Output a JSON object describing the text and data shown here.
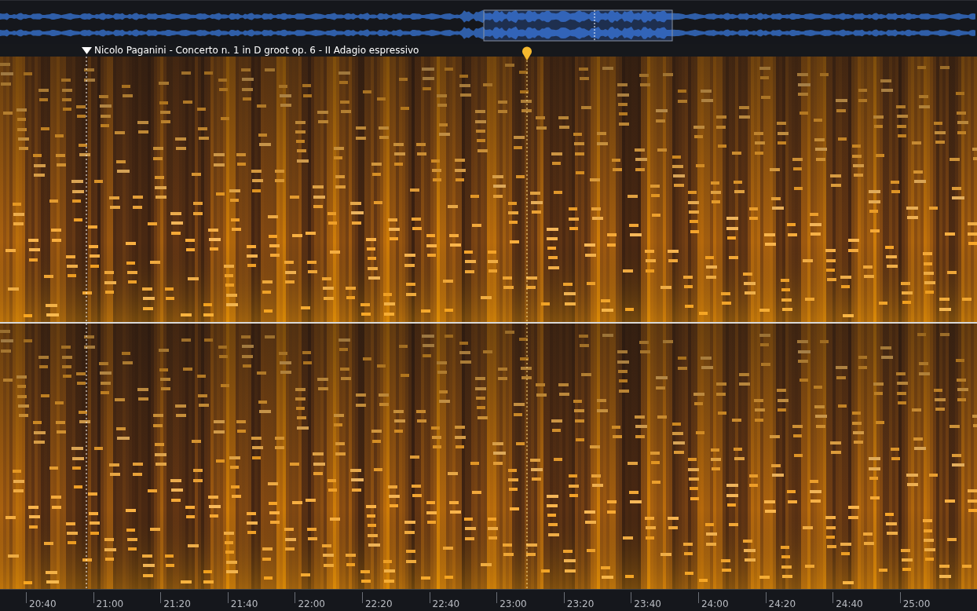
{
  "marker": {
    "label": "Nicolo Paganini -  Concerto n. 1 in D groot op. 6 - II Adagio espressivo"
  },
  "timeline": {
    "ticks": [
      "20:40",
      "21:00",
      "21:20",
      "21:40",
      "22:00",
      "22:20",
      "22:40",
      "23:00",
      "23:20",
      "23:40",
      "24:00",
      "24:20",
      "24:40",
      "25:00"
    ]
  }
}
